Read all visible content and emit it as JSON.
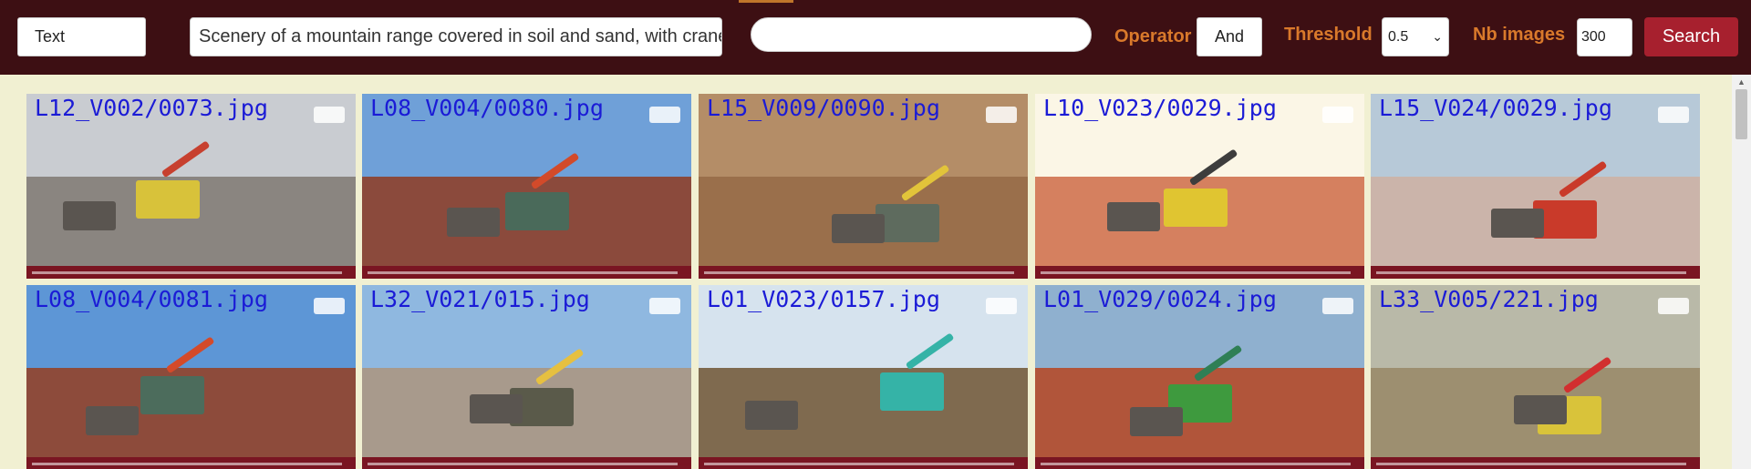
{
  "toolbar": {
    "mode": "Text",
    "query": "Scenery of a mountain range covered in soil and sand, with cranes",
    "query2_placeholder": "",
    "operator_label": "Operator",
    "operator_value": "And",
    "threshold_label": "Threshold",
    "threshold_value": "0.5",
    "nb_label": "Nb images",
    "nb_value": "300",
    "search_label": "Search"
  },
  "colors": {
    "header_bg": "#3d0f13",
    "page_bg": "#f1f0d2",
    "label_orange": "#d9792b",
    "search_red": "#a7202e",
    "filename_blue": "#1b1bd6"
  },
  "results": [
    {
      "file": "L12_V002/0073.jpg",
      "sky": "#c9ccd1",
      "ground": "#8a8580",
      "machine": "#d8c23a",
      "arm": "#c7402f"
    },
    {
      "file": "L08_V004/0080.jpg",
      "sky": "#6fa0d8",
      "ground": "#8b4a3c",
      "machine": "#4a6a5a",
      "arm": "#d24a2a"
    },
    {
      "file": "L15_V009/0090.jpg",
      "sky": "#b48d67",
      "ground": "#9a6f4b",
      "machine": "#5e6b5e",
      "arm": "#e2c43a"
    },
    {
      "file": "L10_V023/0029.jpg",
      "sky": "#fbf6e6",
      "ground": "#d5805f",
      "machine": "#e0c531",
      "arm": "#3d3d3d"
    },
    {
      "file": "L15_V024/0029.jpg",
      "sky": "#b7c9d8",
      "ground": "#cbb4aa",
      "machine": "#c93a2a",
      "arm": "#c93a2a"
    },
    {
      "file": "L08_V004/0081.jpg",
      "sky": "#5d96d6",
      "ground": "#8d4b3b",
      "machine": "#4c6c5c",
      "arm": "#d44a2a"
    },
    {
      "file": "L32_V021/015.jpg",
      "sky": "#8fb8e0",
      "ground": "#a89a8c",
      "machine": "#5a5a4a",
      "arm": "#e6c040"
    },
    {
      "file": "L01_V023/0157.jpg",
      "sky": "#d6e3ee",
      "ground": "#7f6a4f",
      "machine": "#35b3a7",
      "arm": "#35b3a7"
    },
    {
      "file": "L01_V029/0024.jpg",
      "sky": "#8fb0cf",
      "ground": "#b1553a",
      "machine": "#3e9a3e",
      "arm": "#2f7f55"
    },
    {
      "file": "L33_V005/221.jpg",
      "sky": "#b9b9a8",
      "ground": "#9d8f70",
      "machine": "#d9c33a",
      "arm": "#d22f2f"
    }
  ]
}
